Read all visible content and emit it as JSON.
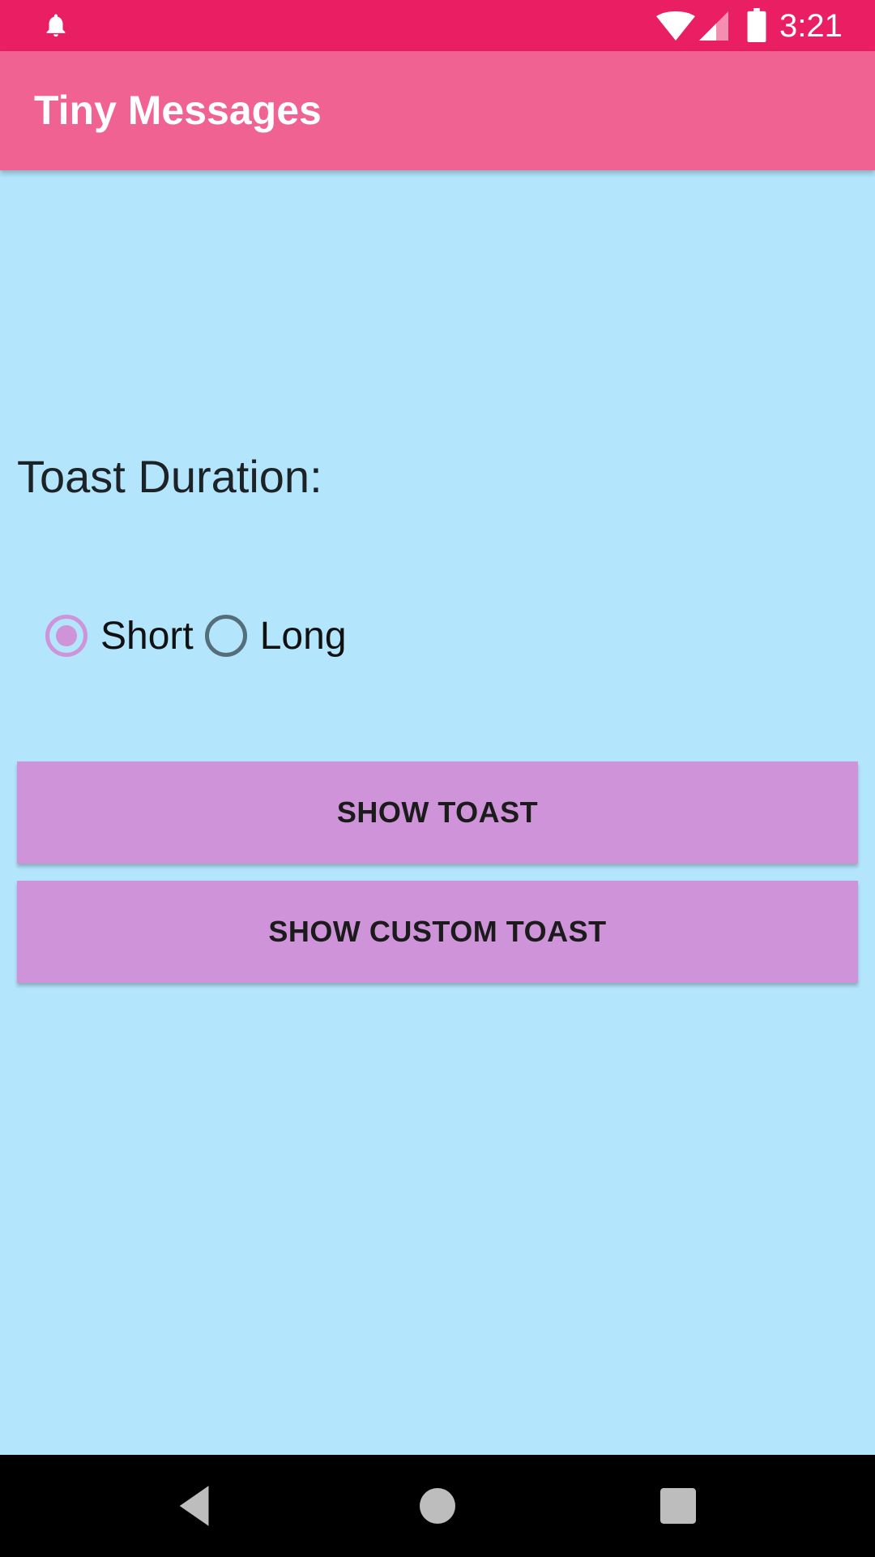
{
  "status_bar": {
    "time": "3:21",
    "background_color": "#E91E63",
    "icons": [
      "notification-bell-icon",
      "wifi-icon",
      "cellular-signal-icon",
      "battery-icon"
    ]
  },
  "app_bar": {
    "title": "Tiny Messages",
    "background_color": "#F06292"
  },
  "content": {
    "background_color": "#B3E5FC",
    "duration_label": "Toast Duration:",
    "radio_options": [
      {
        "label": "Short",
        "checked": true
      },
      {
        "label": "Long",
        "checked": false
      }
    ],
    "buttons": {
      "show_toast": "SHOW TOAST",
      "show_custom_toast": "SHOW CUSTOM TOAST"
    },
    "accent_color": "#CE93D8"
  },
  "nav_bar": {
    "icons": [
      "back-icon",
      "home-icon",
      "recents-icon"
    ]
  }
}
